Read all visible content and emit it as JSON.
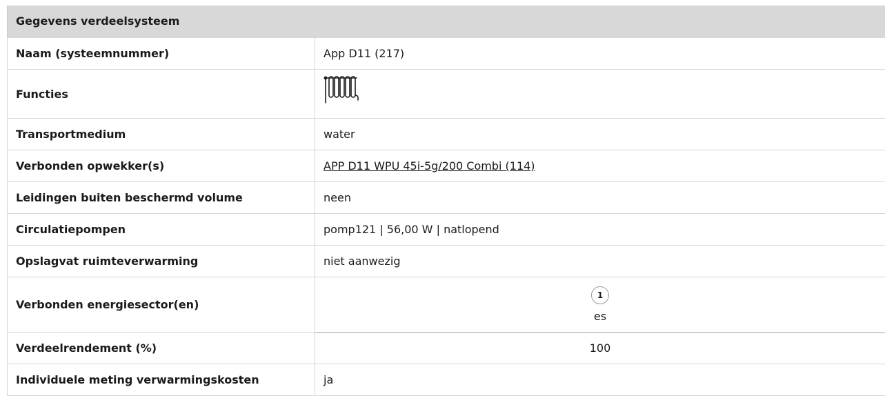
{
  "header": {
    "title": "Gegevens verdeelsysteem"
  },
  "rows": {
    "naam": {
      "label": "Naam (systeemnummer)",
      "value": "App D11 (217)"
    },
    "functies": {
      "label": "Functies",
      "icon": "radiator-icon"
    },
    "transport": {
      "label": "Transportmedium",
      "value": "water"
    },
    "opwekker": {
      "label": "Verbonden opwekker(s)",
      "value": "APP D11 WPU 45i-5g/200 Combi (114)"
    },
    "leidingen": {
      "label": "Leidingen buiten beschermd volume",
      "value": "neen"
    },
    "pompen": {
      "label": "Circulatiepompen",
      "value": "pomp121 | 56,00 W | natlopend"
    },
    "opslagvat": {
      "label": "Opslagvat ruimteverwarming",
      "value": "niet aanwezig"
    },
    "sector": {
      "label": "Verbonden energiesector(en)",
      "badge": "1",
      "name": "es"
    },
    "rendement": {
      "label": "Verdeelrendement (%)",
      "value": "100"
    },
    "meting": {
      "label": "Individuele meting verwarmingskosten",
      "value": "ja"
    }
  }
}
